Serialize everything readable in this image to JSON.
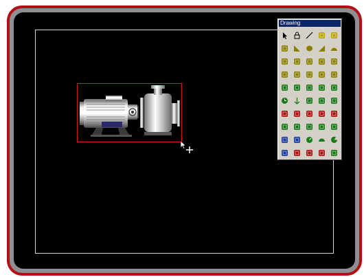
{
  "palette": {
    "title": "Drawing",
    "tools": [
      {
        "icon": "pointer-icon",
        "color": "#000000"
      },
      {
        "icon": "lock-icon",
        "color": "#000000"
      },
      {
        "icon": "line-icon",
        "color": "#000000"
      },
      {
        "icon": "rectangle-icon",
        "color": "#b8a400"
      },
      {
        "icon": "rounded-rectangle-icon",
        "color": "#b8a400"
      },
      {
        "icon": "3d-rectangle-icon",
        "color": "#8a7f00"
      },
      {
        "icon": "triangle-icon",
        "color": "#8a7f00"
      },
      {
        "icon": "ellipse-icon",
        "color": "#8a7f00"
      },
      {
        "icon": "wedge-icon",
        "color": "#8a7f00"
      },
      {
        "icon": "arc-icon",
        "color": "#8a7f00"
      },
      {
        "icon": "meter-icon",
        "color": "#8a7f00"
      },
      {
        "icon": "tank-icon",
        "color": "#8a7f00"
      },
      {
        "icon": "bar-graph-icon",
        "color": "#8a7f00"
      },
      {
        "icon": "histogram-icon",
        "color": "#8a7f00"
      },
      {
        "icon": "xy-plot-icon",
        "color": "#8a7f00"
      },
      {
        "icon": "vertical-scale-icon",
        "color": "#8a7f00"
      },
      {
        "icon": "horizontal-scale-icon",
        "color": "#8a7f00"
      },
      {
        "icon": "shield-icon",
        "color": "#8a7f00"
      },
      {
        "icon": "bucket-icon",
        "color": "#8a7f00"
      },
      {
        "icon": "lamp-icon",
        "color": "#8a7f00"
      },
      {
        "icon": "numeric-display-icon",
        "color": "#1a7a1a"
      },
      {
        "icon": "numeric-entry-icon",
        "color": "#1a7a1a"
      },
      {
        "icon": "push-button-icon",
        "color": "#1a7a1a"
      },
      {
        "icon": "switch-icon",
        "color": "#1a7a1a"
      },
      {
        "icon": "multistate-icon",
        "color": "#1a7a1a"
      },
      {
        "icon": "clock-icon",
        "color": "#1a7a1a"
      },
      {
        "icon": "down-arrow-icon",
        "color": "#1a7a1a"
      },
      {
        "icon": "slider-icon",
        "color": "#1a7a1a"
      },
      {
        "icon": "level-icon",
        "color": "#1a7a1a"
      },
      {
        "icon": "battery-icon",
        "color": "#1a7a1a"
      },
      {
        "icon": "alarm-banner-icon",
        "color": "#b01010"
      },
      {
        "icon": "alarm-icon",
        "color": "#b01010"
      },
      {
        "icon": "speaker-icon",
        "color": "#b01010"
      },
      {
        "icon": "alarm-list-icon",
        "color": "#b01010"
      },
      {
        "icon": "trend-icon",
        "color": "#b01010"
      },
      {
        "icon": "cylinder-icon",
        "color": "#1a7a1a"
      },
      {
        "icon": "block-icon",
        "color": "#1a7a1a"
      },
      {
        "icon": "valve-icon",
        "color": "#1a7a1a"
      },
      {
        "icon": "flow-icon",
        "color": "#1a7a1a"
      },
      {
        "icon": "chart-icon",
        "color": "#1a7a1a"
      },
      {
        "icon": "io-display-icon",
        "color": "#1a3aa0"
      },
      {
        "icon": "tag-icon",
        "color": "#1a3aa0"
      },
      {
        "icon": "gauge-icon",
        "color": "#1a7a1a"
      },
      {
        "icon": "half-gauge-icon",
        "color": "#1a7a1a"
      },
      {
        "icon": "pie-icon",
        "color": "#1a7a1a"
      },
      {
        "icon": "data-table-icon",
        "color": "#1a3aa0"
      },
      {
        "icon": "recipe-icon",
        "color": "#b01010"
      },
      {
        "icon": "message-icon",
        "color": "#b01010"
      },
      {
        "icon": "camera-icon",
        "color": "#b01010"
      },
      {
        "icon": "tab-icon",
        "color": "#1a7a1a"
      }
    ]
  }
}
